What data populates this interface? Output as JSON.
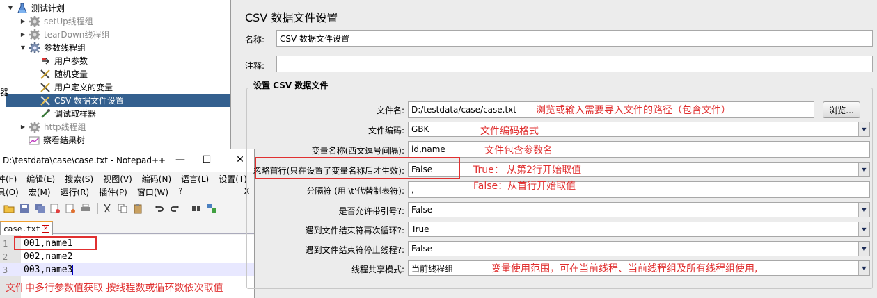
{
  "tree": {
    "items": [
      {
        "label": "测试计划",
        "icon": "flask-icon",
        "toggle": "▼",
        "state": "normal"
      },
      {
        "label": "setUp线程组",
        "icon": "gear-icon",
        "toggle": "▶",
        "state": "disabled"
      },
      {
        "label": "tearDown线程组",
        "icon": "gear-icon",
        "toggle": "▶",
        "state": "disabled"
      },
      {
        "label": "参数线程组",
        "icon": "gear-icon",
        "toggle": "▼",
        "state": "normal"
      },
      {
        "label": "用户参数",
        "icon": "user-param-icon",
        "toggle": "",
        "state": "normal"
      },
      {
        "label": "随机变量",
        "icon": "scissors-icon",
        "toggle": "",
        "state": "normal"
      },
      {
        "label": "用户定义的变量",
        "icon": "scissors-icon",
        "toggle": "",
        "state": "normal"
      },
      {
        "label": "CSV 数据文件设置",
        "icon": "scissors-icon",
        "toggle": "",
        "state": "selected"
      },
      {
        "label": "调试取样器",
        "icon": "pipette-icon",
        "toggle": "",
        "state": "normal"
      },
      {
        "label": "http线程组",
        "icon": "gear-icon",
        "toggle": "▶",
        "state": "disabled"
      },
      {
        "label": "察看结果树",
        "icon": "chart-icon",
        "toggle": "",
        "state": "normal"
      }
    ],
    "edge_glyph": "器"
  },
  "notepad": {
    "title": "D:\\testdata\\case\\case.txt - Notepad++",
    "minimize": "—",
    "maximize": "☐",
    "close": "✕",
    "menu_row1": [
      "件(F)",
      "编辑(E)",
      "搜索(S)",
      "视图(V)",
      "编码(N)",
      "语言(L)",
      "设置(T)"
    ],
    "menu_row2": [
      "具(O)",
      "宏(M)",
      "运行(R)",
      "插件(P)",
      "窗口(W)",
      "?"
    ],
    "menu_close": "X",
    "tab_label": "case.txt",
    "lines": [
      {
        "num": "1",
        "text": "001,name1"
      },
      {
        "num": "2",
        "text": "002,name2"
      },
      {
        "num": "3",
        "text": "003,name3"
      }
    ]
  },
  "form": {
    "title": "CSV 数据文件设置",
    "name_label": "名称:",
    "name_value": "CSV 数据文件设置",
    "comment_label": "注释:",
    "comment_value": "",
    "section_title": "设置 CSV 数据文件",
    "browse_label": "浏览...",
    "rows": [
      {
        "label": "文件名:",
        "value": "D:/testdata/case/case.txt",
        "kind": "text"
      },
      {
        "label": "文件编码:",
        "value": "GBK",
        "kind": "combo"
      },
      {
        "label": "变量名称(西文逗号间隔):",
        "value": "id,name",
        "kind": "text"
      },
      {
        "label": "忽略首行(只在设置了变量名称后才生效):",
        "value": "False",
        "kind": "combo"
      },
      {
        "label": "分隔符 (用'\\t'代替制表符):",
        "value": ",",
        "kind": "text"
      },
      {
        "label": "是否允许带引号?:",
        "value": "False",
        "kind": "combo"
      },
      {
        "label": "遇到文件结束符再次循环?:",
        "value": "True",
        "kind": "combo"
      },
      {
        "label": "遇到文件结束符停止线程?:",
        "value": "False",
        "kind": "combo"
      },
      {
        "label": "线程共享模式:",
        "value": "当前线程组",
        "kind": "combo"
      }
    ]
  },
  "annotations": {
    "path": "浏览或输入需要导入文件的路径（包含文件）",
    "encoding": "文件编码格式",
    "varnames": "文件包含参数名",
    "true_note": "True： 从第2行开始取值",
    "false_note": "False：从首行开始取值",
    "sharing": "变量使用范围，可在当前线程、当前线程组及所有线程组使用,",
    "notepad_note": "文件中多行参数值获取 按线程数或循环数依次取值"
  },
  "colors": {
    "annotation": "#e03030",
    "selection": "#34608f"
  }
}
